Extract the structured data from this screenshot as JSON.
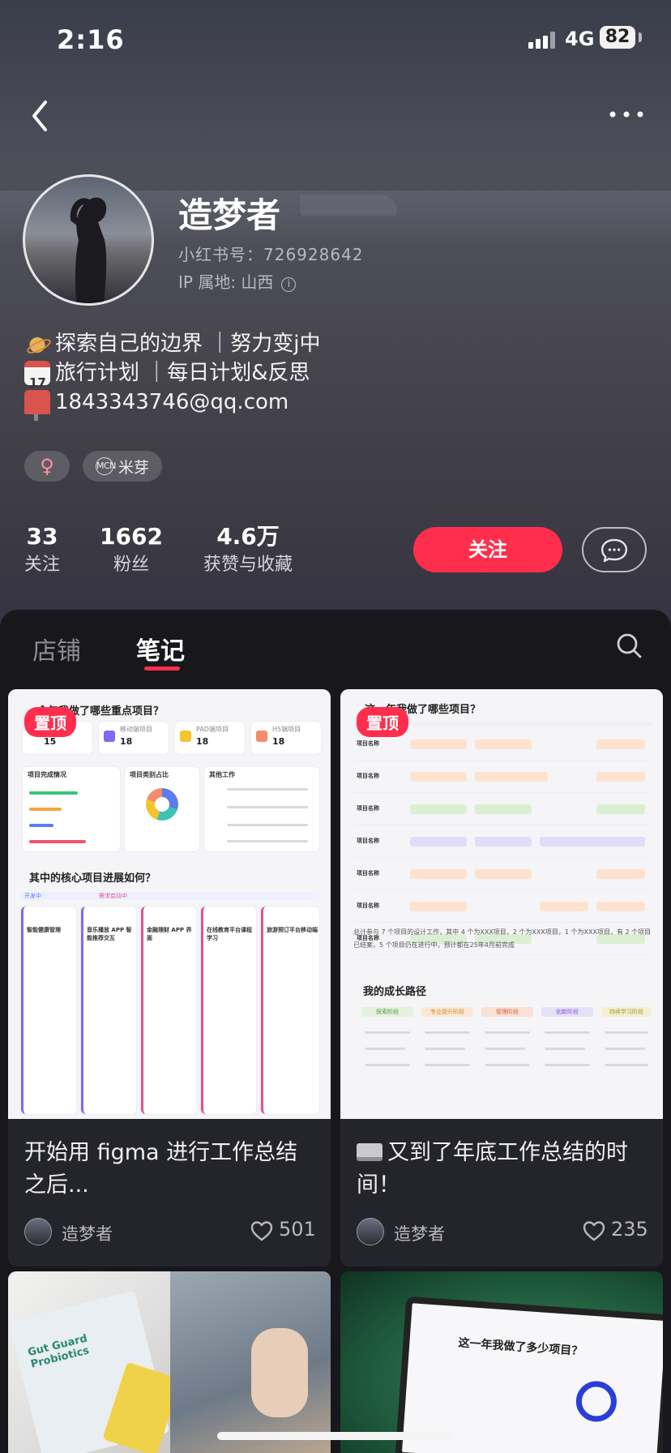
{
  "status": {
    "time": "2:16",
    "network": "4G",
    "battery": "82"
  },
  "profile": {
    "name": "造梦者",
    "red_id": "小红书号：726928642",
    "ip_location": "IP 属地: 山西",
    "ip_info_icon": "info-icon",
    "bio": [
      {
        "icon": "planet-icon",
        "text": "探索自己的边界 ｜努力变j中"
      },
      {
        "icon": "calendar-icon",
        "text": "旅行计划 ｜每日计划&反思"
      },
      {
        "icon": "mailbox-icon",
        "text": "1843343746@qq.com"
      }
    ],
    "tags": {
      "gender": "♀",
      "mcn_badge": "MCN",
      "mcn_name": "米芽"
    },
    "stats": [
      {
        "value": "33",
        "label": "关注"
      },
      {
        "value": "1662",
        "label": "粉丝"
      },
      {
        "value": "4.6万",
        "label": "获赞与收藏"
      }
    ],
    "follow_label": "关注"
  },
  "tabs": {
    "shop": "店铺",
    "notes": "笔记"
  },
  "notes": [
    {
      "pin_label": "置顶",
      "title": "开始用 figma 进行工作总结之后...",
      "author": "造梦者",
      "likes": "501",
      "thumb": {
        "heading1": "今年我做了哪些重点项目？",
        "metrics": [
          {
            "label": "",
            "value": "15"
          },
          {
            "label": "移动端项目",
            "value": "18"
          },
          {
            "label": "PAD端项目",
            "value": "18"
          },
          {
            "label": "H5端项目",
            "value": "18"
          }
        ],
        "sec_labels": [
          "项目完成情况",
          "项目类别占比",
          "其他工作"
        ],
        "heading2": "其中的核心项目进展如何？",
        "lane_labels": [
          "开发中",
          "需求启动中"
        ],
        "project_names": [
          "智能健康管理",
          "音乐播放 APP 智能推荐交互",
          "金融理财 APP 界面",
          "在线教育平台课程学习",
          "旅游预订平台移动端"
        ]
      }
    },
    {
      "pin_label": "置顶",
      "title": "又到了年底工作总结的时间！",
      "author": "造梦者",
      "likes": "235",
      "thumb": {
        "heading1": "这一年我做了哪些项目？",
        "summary": "总计参与 7 个项目的设计工作，其中 4 个为XXX项目，2 个为XXX项目，1 个为XXX项目，有 2 个项目已结案，5 个项目仍在进行中，预计都在25年4月前完成",
        "heading2": "我的成长路径",
        "growth_cols": [
          "探索阶段",
          "专业提升阶段",
          "管理阶段",
          "创新阶段",
          "持续学习阶段"
        ],
        "row_label": "项目名称"
      }
    }
  ],
  "bottom_photos": {
    "left_product": "Gut Guard Probiotics",
    "right_screen_title": "这一年我做了多少项目？"
  },
  "colors": {
    "accent": "#ff2e4d",
    "bg_dark": "#17171c",
    "card": "#24242b"
  }
}
